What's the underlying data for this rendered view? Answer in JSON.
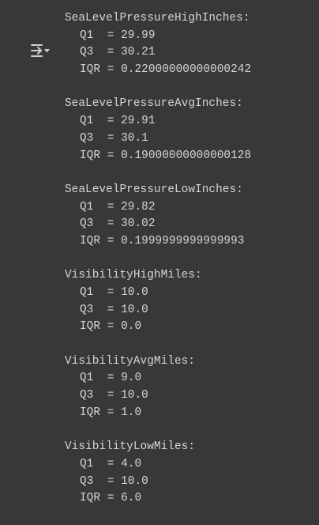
{
  "output": {
    "toggle_icon": "output-toggle-icon",
    "blocks": [
      {
        "title": "SeaLevelPressureHighInches:",
        "q1": "Q1  = 29.99",
        "q3": "Q3  = 30.21",
        "iqr": "IQR = 0.22000000000000242"
      },
      {
        "title": "SeaLevelPressureAvgInches:",
        "q1": "Q1  = 29.91",
        "q3": "Q3  = 30.1",
        "iqr": "IQR = 0.19000000000000128"
      },
      {
        "title": "SeaLevelPressureLowInches:",
        "q1": "Q1  = 29.82",
        "q3": "Q3  = 30.02",
        "iqr": "IQR = 0.1999999999999993"
      },
      {
        "title": "VisibilityHighMiles:",
        "q1": "Q1  = 10.0",
        "q3": "Q3  = 10.0",
        "iqr": "IQR = 0.0"
      },
      {
        "title": "VisibilityAvgMiles:",
        "q1": "Q1  = 9.0",
        "q3": "Q3  = 10.0",
        "iqr": "IQR = 1.0"
      },
      {
        "title": "VisibilityLowMiles:",
        "q1": "Q1  = 4.0",
        "q3": "Q3  = 10.0",
        "iqr": "IQR = 6.0"
      }
    ]
  }
}
